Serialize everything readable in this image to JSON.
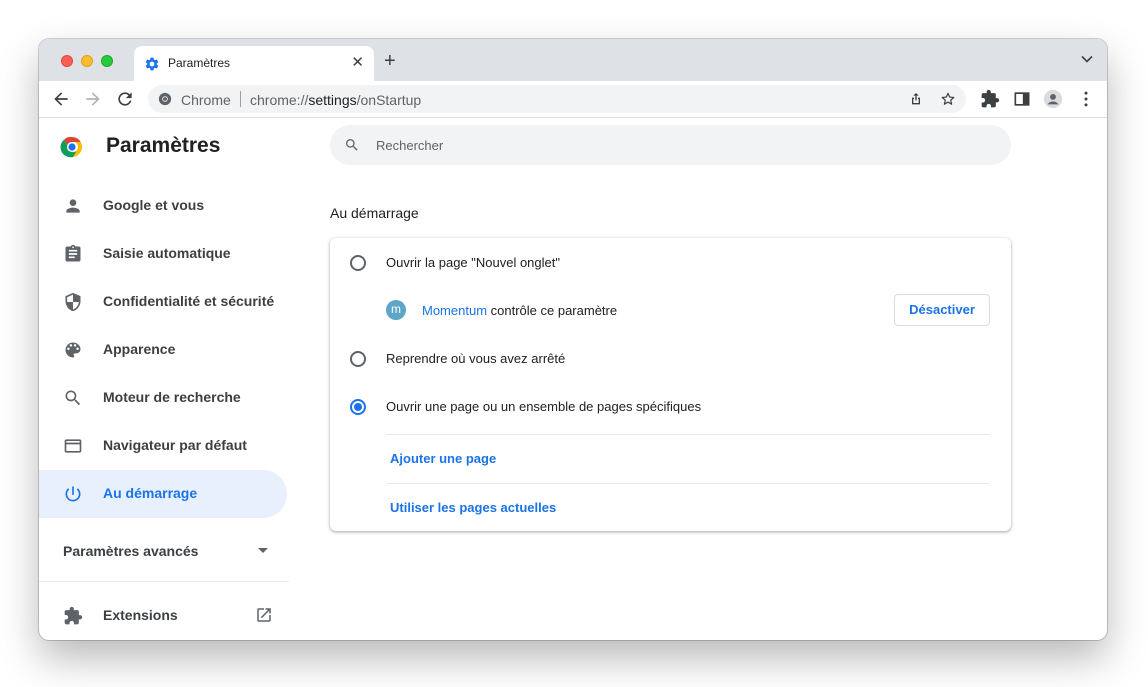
{
  "browser": {
    "tab_title": "Paramètres",
    "tab_close": "✕",
    "new_tab": "+",
    "omnibox_chip": "Chrome",
    "url_scheme": "chrome://",
    "url_host": "settings",
    "url_path": "/onStartup"
  },
  "sidebar": {
    "title": "Paramètres",
    "items": [
      {
        "label": "Google et vous",
        "icon": "person-icon"
      },
      {
        "label": "Saisie automatique",
        "icon": "clipboard-icon"
      },
      {
        "label": "Confidentialité et sécurité",
        "icon": "shield-icon"
      },
      {
        "label": "Apparence",
        "icon": "palette-icon"
      },
      {
        "label": "Moteur de recherche",
        "icon": "search-icon"
      },
      {
        "label": "Navigateur par défaut",
        "icon": "browser-window-icon"
      },
      {
        "label": "Au démarrage",
        "icon": "power-icon",
        "active": true
      }
    ],
    "advanced_label": "Paramètres avancés",
    "extensions_label": "Extensions"
  },
  "main": {
    "search_placeholder": "Rechercher",
    "section_title": "Au démarrage",
    "options": [
      {
        "label": "Ouvrir la page \"Nouvel onglet\"",
        "checked": false
      },
      {
        "label": "Reprendre où vous avez arrêté",
        "checked": false
      },
      {
        "label": "Ouvrir une page ou un ensemble de pages spécifiques",
        "checked": true
      }
    ],
    "extension_notice": {
      "badge": "m",
      "name": "Momentum",
      "text": " contrôle ce paramètre",
      "button": "Désactiver"
    },
    "links": {
      "add_page": "Ajouter une page",
      "use_current": "Utiliser les pages actuelles"
    }
  },
  "colors": {
    "accent": "#1a73e8",
    "active_bg": "#e8f0fe",
    "tabstrip": "#dee1e6"
  }
}
